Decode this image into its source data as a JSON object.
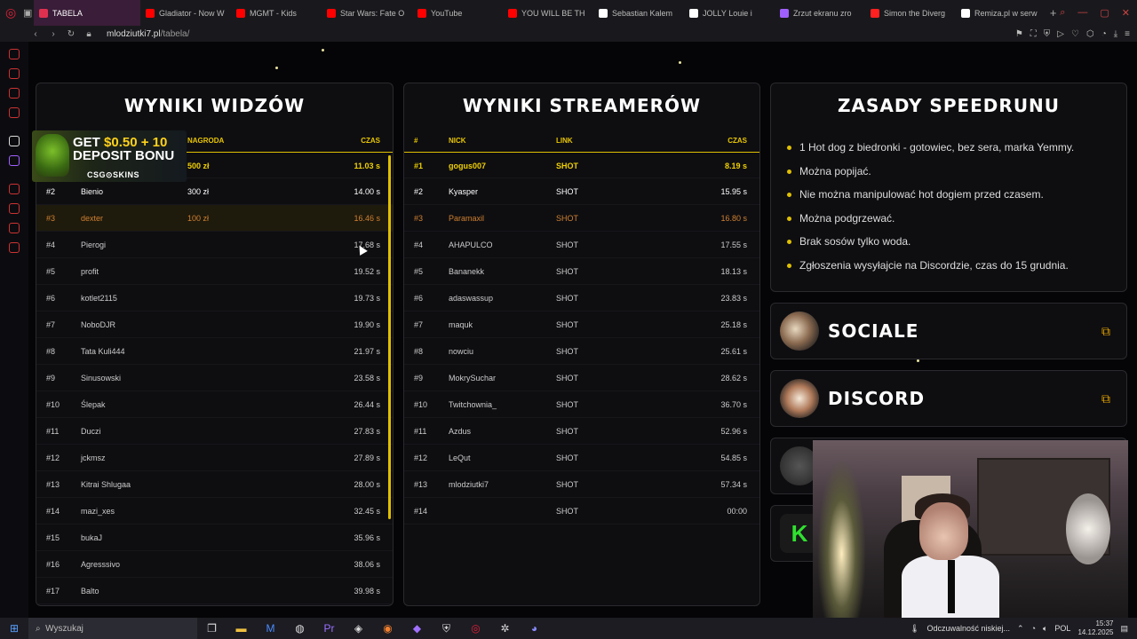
{
  "browser": {
    "tabs": [
      {
        "label": "TABELA",
        "active": true
      },
      {
        "label": "Gladiator - Now W"
      },
      {
        "label": "MGMT - Kids"
      },
      {
        "label": "Star Wars: Fate O"
      },
      {
        "label": "YouTube"
      },
      {
        "label": "YOU WILL BE TH"
      },
      {
        "label": "Sebastian Kalem"
      },
      {
        "label": "JOLLY Louie i"
      },
      {
        "label": "Zrzut ekranu zro"
      },
      {
        "label": "Simon the Diverg"
      },
      {
        "label": "Remiza.pl w serw"
      }
    ],
    "url_host": "mlodziutki7.pl",
    "url_path": "/tabela/"
  },
  "viewers": {
    "title": "WYNIKI WIDZÓW",
    "headers": {
      "prize": "NAGRODA",
      "time": "CZAS"
    },
    "rows": [
      {
        "rank": "#1",
        "nick": "",
        "prize": "500 zł",
        "time": "11.03 s"
      },
      {
        "rank": "#2",
        "nick": "Bienio",
        "prize": "300 zł",
        "time": "14.00 s"
      },
      {
        "rank": "#3",
        "nick": "dexter",
        "prize": "100 zł",
        "time": "16.46 s"
      },
      {
        "rank": "#4",
        "nick": "Pierogi",
        "prize": "",
        "time": "17.68 s"
      },
      {
        "rank": "#5",
        "nick": "profit",
        "prize": "",
        "time": "19.52 s"
      },
      {
        "rank": "#6",
        "nick": "kotlet2115",
        "prize": "",
        "time": "19.73 s"
      },
      {
        "rank": "#7",
        "nick": "NoboDJR",
        "prize": "",
        "time": "19.90 s"
      },
      {
        "rank": "#8",
        "nick": "Tata Kuli444",
        "prize": "",
        "time": "21.97 s"
      },
      {
        "rank": "#9",
        "nick": "Sinusowski",
        "prize": "",
        "time": "23.58 s"
      },
      {
        "rank": "#10",
        "nick": "Ślepak",
        "prize": "",
        "time": "26.44 s"
      },
      {
        "rank": "#11",
        "nick": "Duczi",
        "prize": "",
        "time": "27.83 s"
      },
      {
        "rank": "#12",
        "nick": "jckmsz",
        "prize": "",
        "time": "27.89 s"
      },
      {
        "rank": "#13",
        "nick": "Kitrai Shlugaa",
        "prize": "",
        "time": "28.00 s"
      },
      {
        "rank": "#14",
        "nick": "mazi_xes",
        "prize": "",
        "time": "32.45 s"
      },
      {
        "rank": "#15",
        "nick": "bukaJ",
        "prize": "",
        "time": "35.96 s"
      },
      {
        "rank": "#16",
        "nick": "Agresssivo",
        "prize": "",
        "time": "38.06 s"
      },
      {
        "rank": "#17",
        "nick": "Balto",
        "prize": "",
        "time": "39.98 s"
      }
    ]
  },
  "streamers": {
    "title": "WYNIKI STREAMERÓW",
    "headers": {
      "rank": "#",
      "nick": "NICK",
      "link": "LINK",
      "time": "CZAS"
    },
    "rows": [
      {
        "rank": "#1",
        "nick": "gogus007",
        "link": "SHOT",
        "time": "8.19 s"
      },
      {
        "rank": "#2",
        "nick": "Kyasper",
        "link": "SHOT",
        "time": "15.95 s"
      },
      {
        "rank": "#3",
        "nick": "Paramaxil",
        "link": "SHOT",
        "time": "16.80 s"
      },
      {
        "rank": "#4",
        "nick": "AHAPULCO",
        "link": "SHOT",
        "time": "17.55 s"
      },
      {
        "rank": "#5",
        "nick": "Bananekk",
        "link": "SHOT",
        "time": "18.13 s"
      },
      {
        "rank": "#6",
        "nick": "adaswassup",
        "link": "SHOT",
        "time": "23.83 s"
      },
      {
        "rank": "#7",
        "nick": "maquk",
        "link": "SHOT",
        "time": "25.18 s"
      },
      {
        "rank": "#8",
        "nick": "nowciu",
        "link": "SHOT",
        "time": "25.61 s"
      },
      {
        "rank": "#9",
        "nick": "MokrySuchar",
        "link": "SHOT",
        "time": "28.62 s"
      },
      {
        "rank": "#10",
        "nick": "Twitchownia_",
        "link": "SHOT",
        "time": "36.70 s"
      },
      {
        "rank": "#11",
        "nick": "Azdus",
        "link": "SHOT",
        "time": "52.96 s"
      },
      {
        "rank": "#12",
        "nick": "LeQut",
        "link": "SHOT",
        "time": "54.85 s"
      },
      {
        "rank": "#13",
        "nick": "mlodziutki7",
        "link": "SHOT",
        "time": "57.34 s"
      },
      {
        "rank": "#14",
        "nick": "",
        "link": "SHOT",
        "time": "00:00"
      }
    ]
  },
  "rules": {
    "title": "ZASADY SPEEDRUNU",
    "items": [
      "1 Hot dog z biedronki - gotowiec, bez sera, marka Yemmy.",
      "Można popijać.",
      "Nie można manipulować hot dogiem przed czasem.",
      "Można podgrzewać.",
      "Brak sosów tylko woda.",
      "Zgłoszenia wysyłajcie na Discordzie, czas do 15 grudnia."
    ]
  },
  "socials": [
    {
      "label": "SOCIALE"
    },
    {
      "label": "DISCORD"
    }
  ],
  "ad": {
    "line1_a": "GET ",
    "line1_b": "$0.50 + 10",
    "line2": "DEPOSIT BONU",
    "brand": "CSG⊙SKINS"
  },
  "taskbar": {
    "search_placeholder": "Wyszukaj",
    "weather": "Odczuwalność niskiej...",
    "lang": "POL",
    "time": "15:37",
    "date": "14.12.2025"
  },
  "colors": {
    "accent": "#e0c000",
    "third": "#d08030",
    "brand": "#e0203a"
  }
}
